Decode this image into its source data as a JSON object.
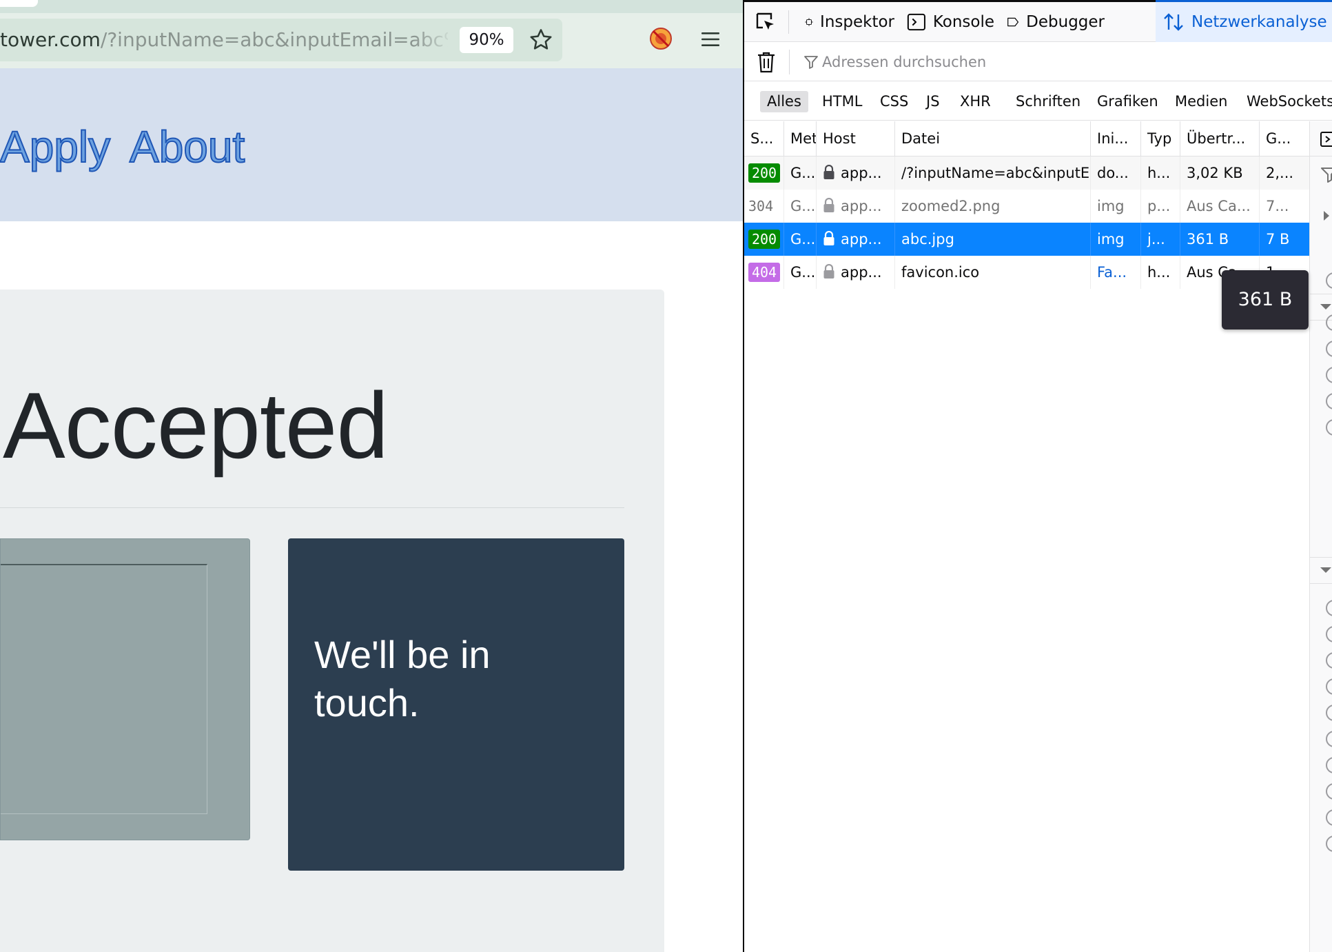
{
  "browser": {
    "url_host": "tower.com",
    "url_path": "/?inputName=abc&inputEmail=abc%",
    "zoom_level": "90%"
  },
  "site": {
    "nav": [
      {
        "label": "Apply"
      },
      {
        "label": "About"
      }
    ],
    "card_title": "Accepted",
    "message": "We'll be in touch."
  },
  "devtools": {
    "tabs": [
      {
        "label": "Inspektor",
        "icon": "inspector-icon"
      },
      {
        "label": "Konsole",
        "icon": "console-icon"
      },
      {
        "label": "Debugger",
        "icon": "debugger-icon"
      },
      {
        "label": "Netzwerkanalyse",
        "icon": "network-icon",
        "active": true
      }
    ],
    "filter_placeholder": "Adressen durchsuchen",
    "type_filters": [
      "Alles",
      "HTML",
      "CSS",
      "JS",
      "XHR",
      "Schriften",
      "Grafiken",
      "Medien",
      "WebSockets"
    ],
    "columns": [
      "S...",
      "Met",
      "Host",
      "Datei",
      "Ini...",
      "Typ",
      "Übertr...",
      "G..."
    ],
    "rows": [
      {
        "status": "200",
        "status_color": "#058b00",
        "method": "G...",
        "host": "app...",
        "file": "/?inputName=abc&inputEm",
        "initiator": "do...",
        "type": "h...",
        "transferred": "3,02 KB",
        "size": "2,..."
      },
      {
        "status": "304",
        "status_color": "",
        "method": "G...",
        "host": "app...",
        "file": "zoomed2.png",
        "initiator": "img",
        "type": "p...",
        "transferred": "Aus Ca...",
        "size": "7..."
      },
      {
        "status": "200",
        "status_color": "#058b00",
        "method": "G...",
        "host": "app...",
        "file": "abc.jpg",
        "initiator": "img",
        "type": "j...",
        "transferred": "361 B",
        "size": "7 B",
        "selected": true
      },
      {
        "status": "404",
        "status_color": "#c46ce7",
        "method": "G...",
        "host": "app...",
        "file": "favicon.ico",
        "initiator": "Fa...",
        "type": "h...",
        "transferred": "Aus Ca...",
        "size": "1..."
      }
    ],
    "tooltip": "361 B"
  },
  "colors": {
    "accent_blue": "#0a60d4",
    "selected_row": "#0a84ff",
    "status_ok": "#058b00",
    "status_not_found": "#c46ce7",
    "header_bg": "#d5dfee",
    "dark_panel": "#2c3e50",
    "gray_panel": "#95a5a6"
  }
}
